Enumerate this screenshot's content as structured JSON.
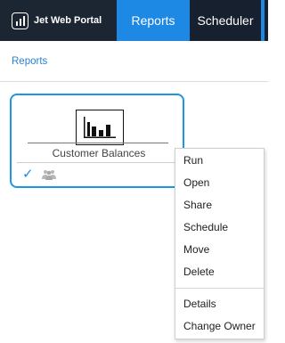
{
  "app": {
    "brand": "Jet Web Portal"
  },
  "nav": {
    "tabs": [
      {
        "label": "Reports",
        "active": true
      },
      {
        "label": "Scheduler",
        "active": false
      }
    ]
  },
  "breadcrumb": {
    "label": "Reports"
  },
  "card": {
    "title": "Customer Balances",
    "selected": true
  },
  "context_menu": {
    "items": [
      "Run",
      "Open",
      "Share",
      "Schedule",
      "Move",
      "Delete"
    ],
    "items_secondary": [
      "Details",
      "Change Owner"
    ]
  },
  "colors": {
    "accent": "#1e88e5",
    "topbar": "#16202e",
    "link": "#2a7fd4"
  }
}
